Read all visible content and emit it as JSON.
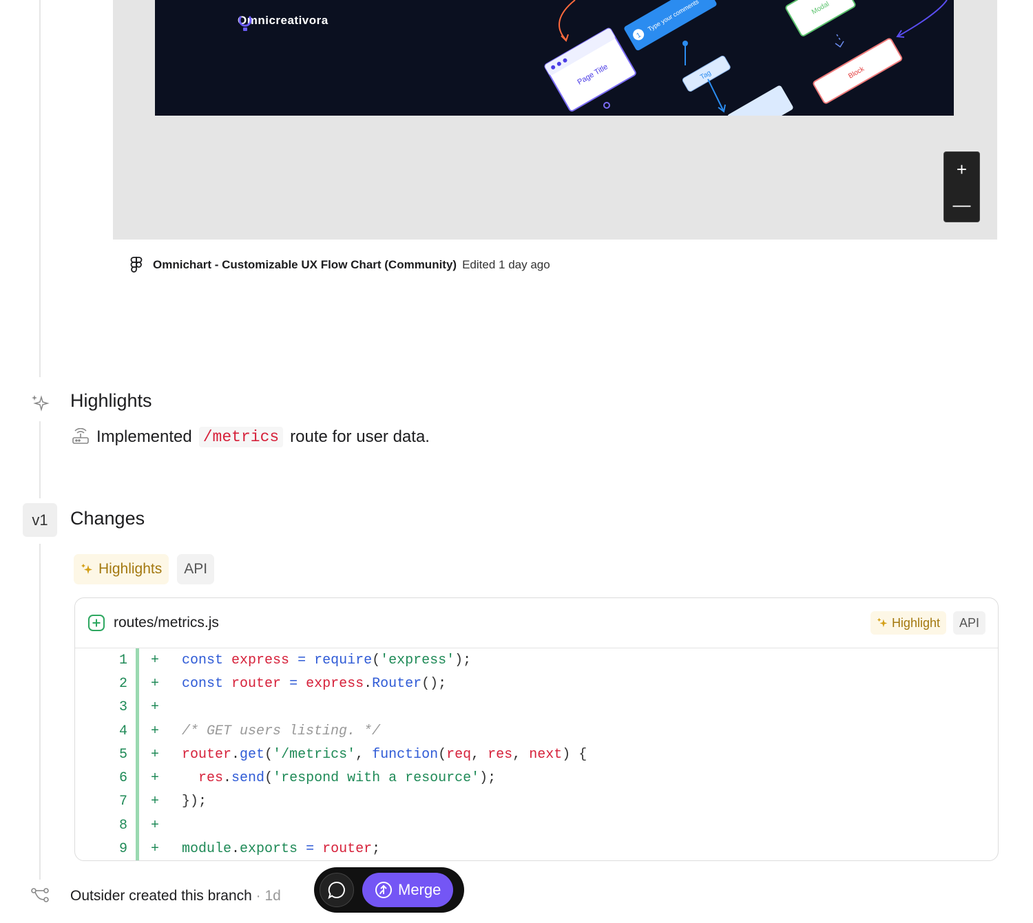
{
  "embed": {
    "brand_name": "Omnicreativora",
    "canvas_labels": {
      "page_title": "Page Title",
      "comment": "Type your comments",
      "tag": "Tag",
      "modal": "Modal",
      "block": "Block"
    },
    "zoom_in": "+",
    "zoom_out": "—",
    "file_name": "Omnichart - Customizable UX Flow Chart (Community)",
    "edited": "Edited 1 day ago"
  },
  "highlights": {
    "title": "Highlights",
    "item_before": "Implemented",
    "item_code": "/metrics",
    "item_after": "route for user data."
  },
  "changes": {
    "version": "v1",
    "title": "Changes",
    "tags": [
      "Highlights",
      "API"
    ],
    "file": {
      "name": "routes/metrics.js",
      "tags": [
        "Highlight",
        "API"
      ],
      "lines": [
        "1",
        "2",
        "3",
        "4",
        "5",
        "6",
        "7",
        "8",
        "9"
      ],
      "added_marker": "+"
    }
  },
  "activity": {
    "branch_text": "Outsider created this branch",
    "branch_time": "· 1d"
  },
  "actions": {
    "merge_label": "Merge"
  },
  "colors": {
    "accent": "#7456f5",
    "added": "#1f8a57",
    "highlight_tag": "#a3780f"
  }
}
